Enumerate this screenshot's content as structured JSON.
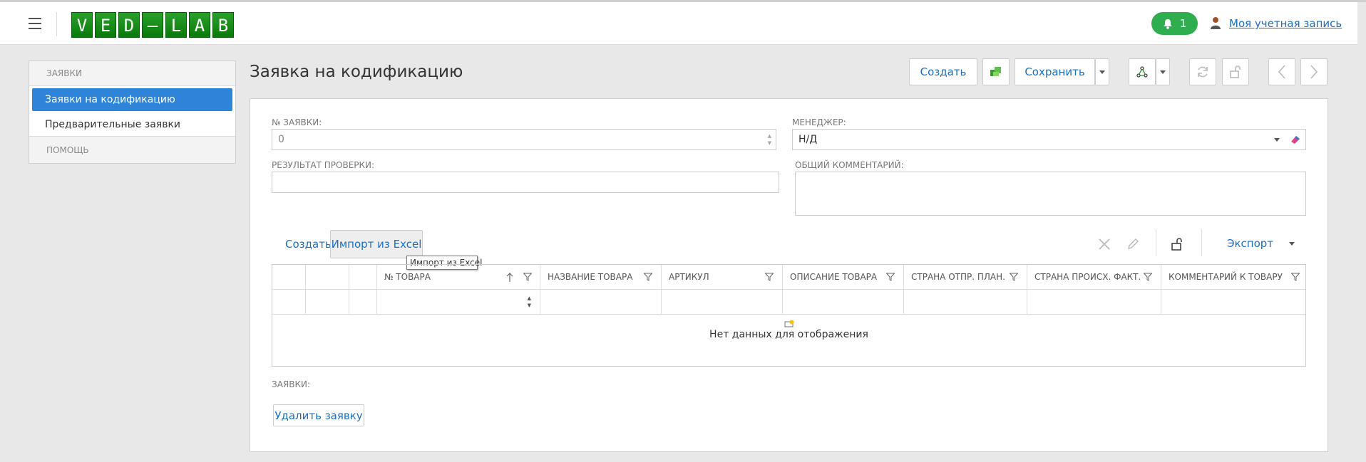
{
  "header": {
    "logo_letters": [
      "V",
      "E",
      "D",
      "–",
      "L",
      "A",
      "B"
    ],
    "notification_count": "1",
    "account_link": "Моя учетная запись"
  },
  "sidebar": {
    "section1": "ЗАЯВКИ",
    "items": [
      {
        "label": "Заявки на кодификацию"
      },
      {
        "label": "Предварительные заявки"
      }
    ],
    "section2": "ПОМОЩЬ"
  },
  "page": {
    "title": "Заявка на кодификацию"
  },
  "toolbar": {
    "create_label": "Создать",
    "save_label": "Сохранить"
  },
  "form": {
    "order_no_label": "№ ЗАЯВКИ:",
    "order_no_value": "0",
    "manager_label": "МЕНЕДЖЕР:",
    "manager_value": "Н/Д",
    "check_result_label": "РЕЗУЛЬТАТ ПРОВЕРКИ:",
    "check_result_value": "",
    "comment_label": "ОБЩИЙ КОММЕНТАРИЙ:",
    "comment_value": ""
  },
  "grid_toolbar": {
    "create_label": "Создать",
    "import_label": "Импорт из Excel",
    "import_tooltip": "Импорт из Excel",
    "export_label": "Экспорт"
  },
  "grid": {
    "columns": [
      "№ ТОВАРА",
      "НАЗВАНИЕ ТОВАРА",
      "АРТИКУЛ",
      "ОПИСАНИЕ ТОВАРА",
      "СТРАНА ОТПР. ПЛАН.",
      "СТРАНА ПРОИСХ. ФАКТ.",
      "КОММЕНТАРИЙ К ТОВАРУ"
    ],
    "empty_text": "Нет данных для отображения"
  },
  "footer": {
    "orders_label": "ЗАЯВКИ:",
    "delete_label": "Удалить заявку"
  },
  "colors": {
    "accent": "#2d84d8",
    "link": "#1a6fc4",
    "notification": "#2eae4e",
    "logo_green": "#0a7a0a"
  }
}
